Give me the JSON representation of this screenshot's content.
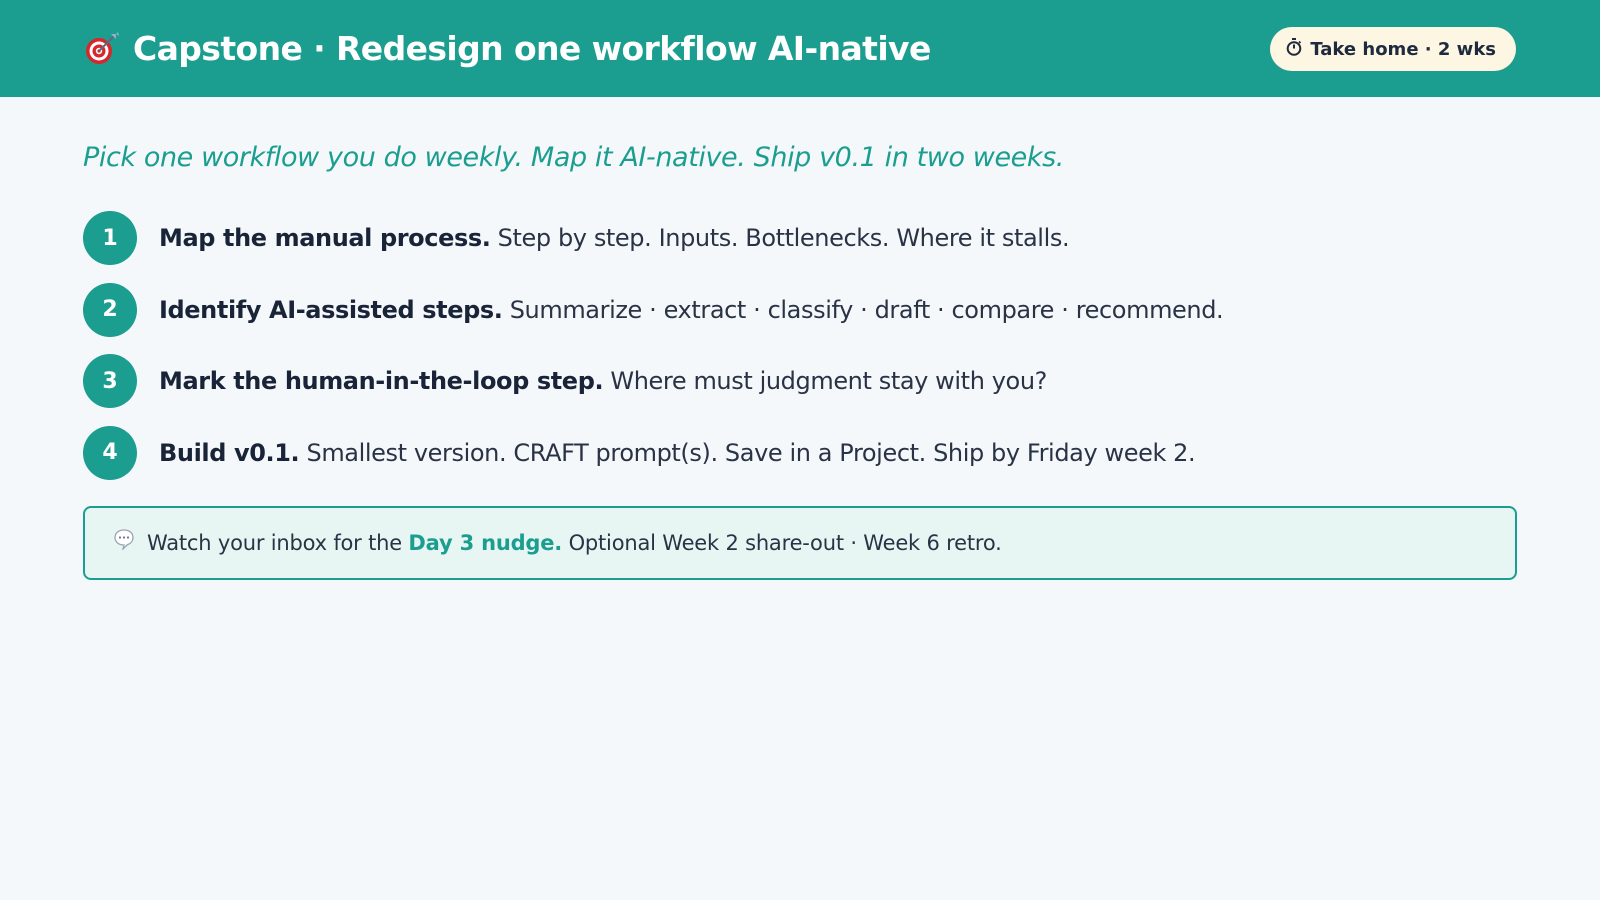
{
  "header": {
    "icon": "target-dart-icon",
    "title": "Capstone · Redesign one workflow AI-native",
    "badge_icon": "stopwatch-icon",
    "badge_label": "Take home · 2 wks"
  },
  "subtitle": "Pick one workflow you do weekly. Map it AI-native. Ship v0.1 in two weeks.",
  "steps": [
    {
      "num": "1",
      "bold": "Map the manual process.",
      "rest": " Step by step. Inputs. Bottlenecks. Where it stalls."
    },
    {
      "num": "2",
      "bold": "Identify AI-assisted steps.",
      "rest": " Summarize · extract · classify · draft · compare · recommend."
    },
    {
      "num": "3",
      "bold": "Mark the human-in-the-loop step.",
      "rest": " Where must judgment stay with you?"
    },
    {
      "num": "4",
      "bold": "Build v0.1.",
      "rest": " Smallest version. CRAFT prompt(s). Save in a Project. Ship by Friday week 2."
    }
  ],
  "note": {
    "icon": "speech-bubble-icon",
    "prefix": "Watch your inbox for the ",
    "highlight": "Day 3 nudge.",
    "suffix": " Optional Week 2 share-out · Week 6 retro."
  },
  "colors": {
    "accent": "#1b9e8f",
    "background": "#f5f8fb",
    "badge_bg": "#fdf6e3",
    "note_bg": "#e8f6f3"
  }
}
